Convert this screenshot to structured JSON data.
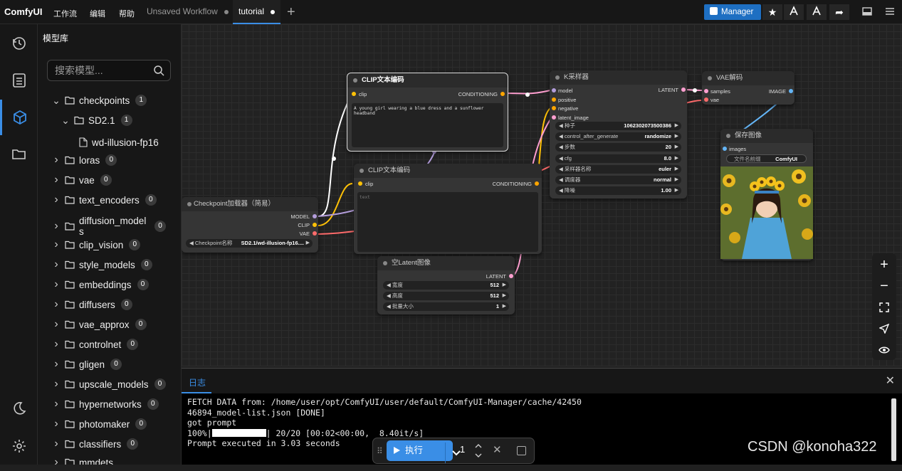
{
  "app": {
    "brand": "ComfyUI",
    "menus": [
      "工作流",
      "编辑",
      "帮助"
    ],
    "tabs": [
      {
        "label": "Unsaved Workflow",
        "active": false
      },
      {
        "label": "tutorial",
        "active": true
      }
    ],
    "manager_label": "Manager",
    "accent": "#3a8ee6"
  },
  "sidebar_icons": [
    "history-icon",
    "queue-icon",
    "model-library-icon",
    "workflows-icon",
    "theme-moon-icon",
    "settings-icon"
  ],
  "panel": {
    "title": "模型库",
    "search_placeholder": "搜索模型...",
    "tree": [
      {
        "label": "checkpoints",
        "count": "1",
        "expanded": true,
        "depth": 0
      },
      {
        "label": "SD2.1",
        "count": "1",
        "expanded": true,
        "depth": 1
      },
      {
        "label": "wd-illusion-fp16",
        "count": "",
        "file": true,
        "depth": 2
      },
      {
        "label": "loras",
        "count": "0",
        "depth": 0
      },
      {
        "label": "vae",
        "count": "0",
        "depth": 0
      },
      {
        "label": "text_encoders",
        "count": "0",
        "depth": 0
      },
      {
        "label": "diffusion_models",
        "count": "0",
        "depth": 0
      },
      {
        "label": "clip_vision",
        "count": "0",
        "depth": 0
      },
      {
        "label": "style_models",
        "count": "0",
        "depth": 0
      },
      {
        "label": "embeddings",
        "count": "0",
        "depth": 0
      },
      {
        "label": "diffusers",
        "count": "0",
        "depth": 0
      },
      {
        "label": "vae_approx",
        "count": "0",
        "depth": 0
      },
      {
        "label": "controlnet",
        "count": "0",
        "depth": 0
      },
      {
        "label": "gligen",
        "count": "0",
        "depth": 0
      },
      {
        "label": "upscale_models",
        "count": "0",
        "depth": 0
      },
      {
        "label": "hypernetworks",
        "count": "0",
        "depth": 0
      },
      {
        "label": "photomaker",
        "count": "0",
        "depth": 0
      },
      {
        "label": "classifiers",
        "count": "0",
        "depth": 0
      },
      {
        "label": "mmdets",
        "count": "",
        "depth": 0
      }
    ]
  },
  "nodes": {
    "clip_top": {
      "title": "CLIP文本编码",
      "in": "clip",
      "out": "CONDITIONING",
      "text": "A young girl wearing a blue dress and a sunflower headband"
    },
    "clip_bottom": {
      "title": "CLIP文本编码",
      "in": "clip",
      "out": "CONDITIONING",
      "text": "text"
    },
    "checkpoint": {
      "title": "Checkpoint加载器（简易）",
      "outs": [
        "MODEL",
        "CLIP",
        "VAE"
      ],
      "widget_label": "Checkpoint名称",
      "widget_value": "SD2.1/wd-illusion-fp16...."
    },
    "ksampler": {
      "title": "K采样器",
      "ins": [
        "model",
        "positive",
        "negative",
        "latent_image"
      ],
      "out": "LATENT",
      "widgets": [
        {
          "label": "种子",
          "value": "1062302073500386"
        },
        {
          "label": "control_after_generate",
          "value": "randomize"
        },
        {
          "label": "步数",
          "value": "20"
        },
        {
          "label": "cfg",
          "value": "8.0"
        },
        {
          "label": "采样器名称",
          "value": "euler"
        },
        {
          "label": "调度器",
          "value": "normal"
        },
        {
          "label": "降噪",
          "value": "1.00"
        }
      ]
    },
    "vae_decode": {
      "title": "VAE解码",
      "ins": [
        "samples",
        "vae"
      ],
      "out": "IMAGE"
    },
    "save_image": {
      "title": "保存图像",
      "in": "images",
      "widget_label": "文件名前缀",
      "widget_value": "ComfyUI"
    },
    "empty_latent": {
      "title": "空Latent图像",
      "out": "LATENT",
      "widgets": [
        {
          "label": "宽度",
          "value": "512"
        },
        {
          "label": "高度",
          "value": "512"
        },
        {
          "label": "批量大小",
          "value": "1"
        }
      ]
    }
  },
  "log": {
    "tab": "日志",
    "lines": [
      "FETCH DATA from: /home/user/opt/ComfyUI/user/default/ComfyUI-Manager/cache/42450",
      "46894_model-list.json [DONE]",
      "got prompt",
      "Prompt executed in 3.03 seconds"
    ],
    "progress_prefix": "100%|",
    "progress_suffix": "| 20/20 [00:02<00:00,  8.40it/s]",
    "progress_fraction": 1.0
  },
  "runbar": {
    "run_label": "执行",
    "queue_count": "1"
  },
  "watermark": "CSDN @konoha322"
}
